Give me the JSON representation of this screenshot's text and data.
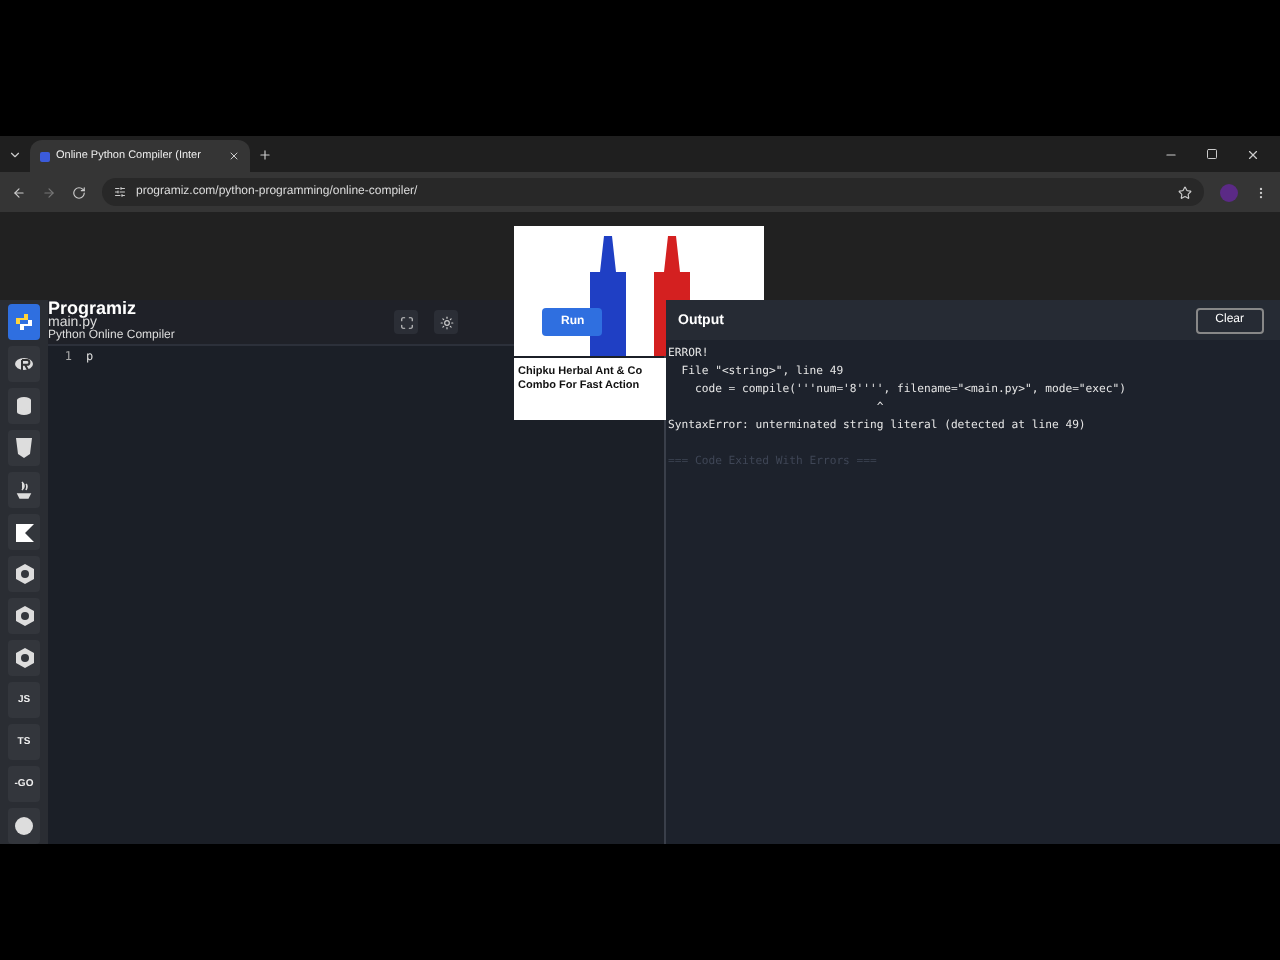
{
  "browser": {
    "tab_title": "Online Python Compiler (Inter",
    "url": "programiz.com/python-programming/online-compiler/"
  },
  "sidebar": {
    "items": [
      {
        "selected": true
      },
      {
        "selected": false
      },
      {
        "selected": false
      },
      {
        "selected": false
      },
      {
        "selected": false
      },
      {
        "selected": false
      },
      {
        "selected": false
      },
      {
        "selected": false
      },
      {
        "selected": false
      },
      {
        "selected": false,
        "label": "JS"
      },
      {
        "selected": false,
        "label": "TS"
      },
      {
        "selected": false,
        "label": "-GO"
      },
      {
        "selected": false
      }
    ]
  },
  "header": {
    "logo": "Programiz",
    "file_name": "main.py",
    "subtitle": "Python Online Compiler",
    "run_button": "Run"
  },
  "editor": {
    "lines": [
      {
        "number": "1",
        "code": "p"
      }
    ]
  },
  "ad": {
    "headline": "Chipku Herbal Ant & Co",
    "subline": "Combo For Fast Action"
  },
  "output": {
    "title": "Output",
    "clear_button": "Clear",
    "lines": [
      {
        "text": "ERROR!",
        "kind": "error"
      },
      {
        "text": "  File \"<string>\", line 49",
        "kind": "error"
      },
      {
        "text": "    code = compile('''num='8'''', filename=\"<main.py>\", mode=\"exec\")",
        "kind": "error"
      },
      {
        "text": "                               ^",
        "kind": "error"
      },
      {
        "text": "SyntaxError: unterminated string literal (detected at line 49)",
        "kind": "error"
      },
      {
        "text": "=== Code Exited With Errors ===",
        "kind": "status"
      }
    ]
  }
}
